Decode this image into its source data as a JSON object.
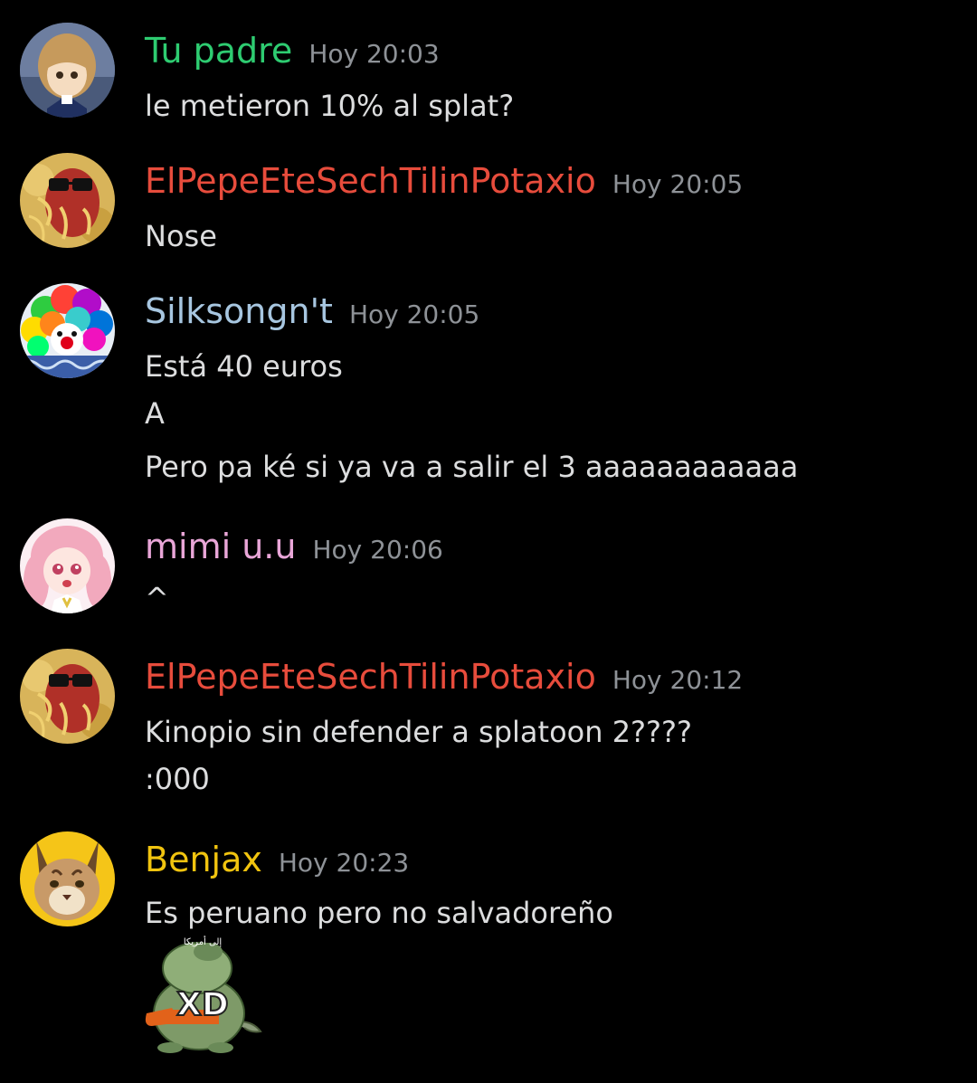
{
  "colors": {
    "background": "#000000",
    "text": "#dcddde",
    "timestamp": "#8e9297"
  },
  "messages": [
    {
      "username": "Tu padre",
      "name_color": "#2ecc71",
      "time": "Hoy 20:03",
      "avatar": "anime-girl-avatar",
      "lines": [
        "le metieron 10% al splat?"
      ]
    },
    {
      "username": "ElPepeEteSechTilinPotaxio",
      "name_color": "#e74c3c",
      "time": "Hoy 20:05",
      "avatar": "pasta-sunglasses-avatar",
      "lines": [
        "Nose"
      ]
    },
    {
      "username": "Silksongn't",
      "name_color": "#a7c6e0",
      "time": "Hoy 20:05",
      "avatar": "rainbow-clown-avatar",
      "lines": [
        "Está 40 euros",
        "A",
        "Pero pa ké si ya va a salir el 3 aaaaaaaaaaaa"
      ]
    },
    {
      "username": "mimi u.u",
      "name_color": "#e9a6d8",
      "time": "Hoy 20:06",
      "avatar": "pink-anime-avatar",
      "lines": [
        "^"
      ]
    },
    {
      "username": "ElPepeEteSechTilinPotaxio",
      "name_color": "#e74c3c",
      "time": "Hoy 20:12",
      "avatar": "pasta-sunglasses-avatar",
      "lines": [
        "Kinopio sin defender a splatoon 2????",
        ":000"
      ]
    },
    {
      "username": "Benjax",
      "name_color": "#f1c40f",
      "time": "Hoy 20:23",
      "avatar": "caracal-cat-avatar",
      "lines": [
        "Es peruano pero no salvadoreño"
      ],
      "sticker": {
        "name": "rat-xd-sticker",
        "text": "XD",
        "caption": "إلى أمريكا"
      }
    }
  ]
}
